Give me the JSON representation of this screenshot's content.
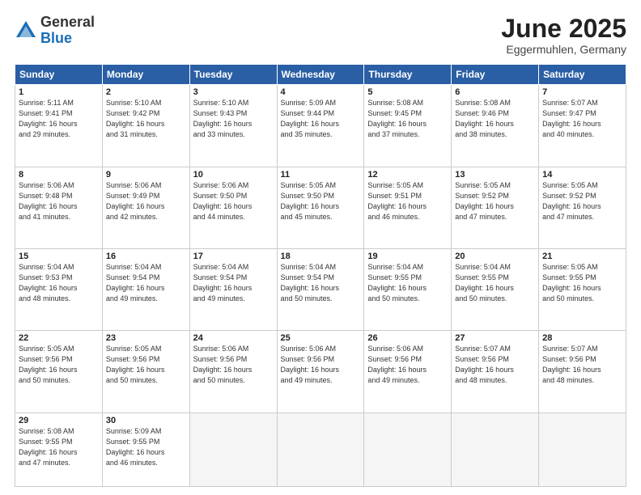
{
  "header": {
    "logo_line1": "General",
    "logo_line2": "Blue",
    "month": "June 2025",
    "location": "Eggermuhlen, Germany"
  },
  "weekdays": [
    "Sunday",
    "Monday",
    "Tuesday",
    "Wednesday",
    "Thursday",
    "Friday",
    "Saturday"
  ],
  "days": [
    {
      "num": "",
      "info": ""
    },
    {
      "num": "",
      "info": ""
    },
    {
      "num": "",
      "info": ""
    },
    {
      "num": "",
      "info": ""
    },
    {
      "num": "",
      "info": ""
    },
    {
      "num": "",
      "info": ""
    },
    {
      "num": "",
      "info": ""
    },
    {
      "num": "1",
      "info": "Sunrise: 5:11 AM\nSunset: 9:41 PM\nDaylight: 16 hours\nand 29 minutes."
    },
    {
      "num": "2",
      "info": "Sunrise: 5:10 AM\nSunset: 9:42 PM\nDaylight: 16 hours\nand 31 minutes."
    },
    {
      "num": "3",
      "info": "Sunrise: 5:10 AM\nSunset: 9:43 PM\nDaylight: 16 hours\nand 33 minutes."
    },
    {
      "num": "4",
      "info": "Sunrise: 5:09 AM\nSunset: 9:44 PM\nDaylight: 16 hours\nand 35 minutes."
    },
    {
      "num": "5",
      "info": "Sunrise: 5:08 AM\nSunset: 9:45 PM\nDaylight: 16 hours\nand 37 minutes."
    },
    {
      "num": "6",
      "info": "Sunrise: 5:08 AM\nSunset: 9:46 PM\nDaylight: 16 hours\nand 38 minutes."
    },
    {
      "num": "7",
      "info": "Sunrise: 5:07 AM\nSunset: 9:47 PM\nDaylight: 16 hours\nand 40 minutes."
    },
    {
      "num": "8",
      "info": "Sunrise: 5:06 AM\nSunset: 9:48 PM\nDaylight: 16 hours\nand 41 minutes."
    },
    {
      "num": "9",
      "info": "Sunrise: 5:06 AM\nSunset: 9:49 PM\nDaylight: 16 hours\nand 42 minutes."
    },
    {
      "num": "10",
      "info": "Sunrise: 5:06 AM\nSunset: 9:50 PM\nDaylight: 16 hours\nand 44 minutes."
    },
    {
      "num": "11",
      "info": "Sunrise: 5:05 AM\nSunset: 9:50 PM\nDaylight: 16 hours\nand 45 minutes."
    },
    {
      "num": "12",
      "info": "Sunrise: 5:05 AM\nSunset: 9:51 PM\nDaylight: 16 hours\nand 46 minutes."
    },
    {
      "num": "13",
      "info": "Sunrise: 5:05 AM\nSunset: 9:52 PM\nDaylight: 16 hours\nand 47 minutes."
    },
    {
      "num": "14",
      "info": "Sunrise: 5:05 AM\nSunset: 9:52 PM\nDaylight: 16 hours\nand 47 minutes."
    },
    {
      "num": "15",
      "info": "Sunrise: 5:04 AM\nSunset: 9:53 PM\nDaylight: 16 hours\nand 48 minutes."
    },
    {
      "num": "16",
      "info": "Sunrise: 5:04 AM\nSunset: 9:54 PM\nDaylight: 16 hours\nand 49 minutes."
    },
    {
      "num": "17",
      "info": "Sunrise: 5:04 AM\nSunset: 9:54 PM\nDaylight: 16 hours\nand 49 minutes."
    },
    {
      "num": "18",
      "info": "Sunrise: 5:04 AM\nSunset: 9:54 PM\nDaylight: 16 hours\nand 50 minutes."
    },
    {
      "num": "19",
      "info": "Sunrise: 5:04 AM\nSunset: 9:55 PM\nDaylight: 16 hours\nand 50 minutes."
    },
    {
      "num": "20",
      "info": "Sunrise: 5:04 AM\nSunset: 9:55 PM\nDaylight: 16 hours\nand 50 minutes."
    },
    {
      "num": "21",
      "info": "Sunrise: 5:05 AM\nSunset: 9:55 PM\nDaylight: 16 hours\nand 50 minutes."
    },
    {
      "num": "22",
      "info": "Sunrise: 5:05 AM\nSunset: 9:56 PM\nDaylight: 16 hours\nand 50 minutes."
    },
    {
      "num": "23",
      "info": "Sunrise: 5:05 AM\nSunset: 9:56 PM\nDaylight: 16 hours\nand 50 minutes."
    },
    {
      "num": "24",
      "info": "Sunrise: 5:06 AM\nSunset: 9:56 PM\nDaylight: 16 hours\nand 50 minutes."
    },
    {
      "num": "25",
      "info": "Sunrise: 5:06 AM\nSunset: 9:56 PM\nDaylight: 16 hours\nand 49 minutes."
    },
    {
      "num": "26",
      "info": "Sunrise: 5:06 AM\nSunset: 9:56 PM\nDaylight: 16 hours\nand 49 minutes."
    },
    {
      "num": "27",
      "info": "Sunrise: 5:07 AM\nSunset: 9:56 PM\nDaylight: 16 hours\nand 48 minutes."
    },
    {
      "num": "28",
      "info": "Sunrise: 5:07 AM\nSunset: 9:56 PM\nDaylight: 16 hours\nand 48 minutes."
    },
    {
      "num": "29",
      "info": "Sunrise: 5:08 AM\nSunset: 9:55 PM\nDaylight: 16 hours\nand 47 minutes."
    },
    {
      "num": "30",
      "info": "Sunrise: 5:09 AM\nSunset: 9:55 PM\nDaylight: 16 hours\nand 46 minutes."
    },
    {
      "num": "",
      "info": ""
    },
    {
      "num": "",
      "info": ""
    },
    {
      "num": "",
      "info": ""
    },
    {
      "num": "",
      "info": ""
    },
    {
      "num": "",
      "info": ""
    }
  ]
}
